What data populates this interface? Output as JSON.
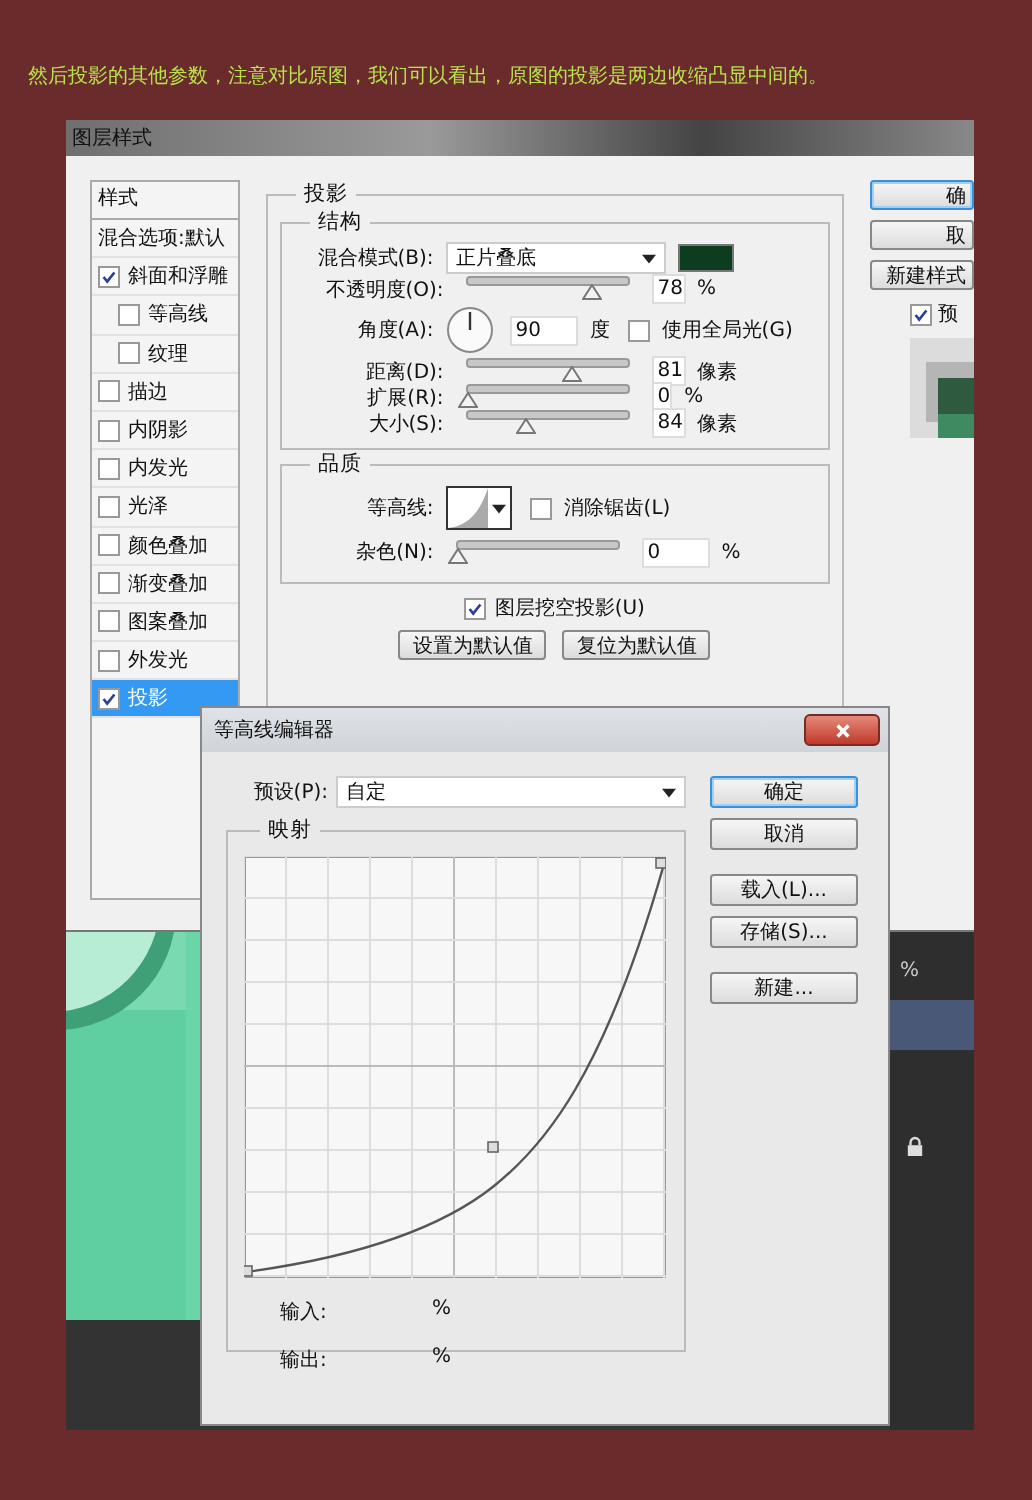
{
  "caption": "然后投影的其他参数，注意对比原图，我们可以看出，原图的投影是两边收缩凸显中间的。",
  "layer_style": {
    "title": "图层样式",
    "styles_header": "样式",
    "styles": [
      {
        "label": "混合选项:默认",
        "kind": "plain",
        "selected": false
      },
      {
        "label": "斜面和浮雕",
        "kind": "check",
        "checked": true,
        "selected": false,
        "children": [
          {
            "label": "等高线",
            "kind": "check",
            "checked": false,
            "selected": false
          },
          {
            "label": "纹理",
            "kind": "check",
            "checked": false,
            "selected": false
          }
        ]
      },
      {
        "label": "描边",
        "kind": "check",
        "checked": false,
        "selected": false
      },
      {
        "label": "内阴影",
        "kind": "check",
        "checked": false,
        "selected": false
      },
      {
        "label": "内发光",
        "kind": "check",
        "checked": false,
        "selected": false
      },
      {
        "label": "光泽",
        "kind": "check",
        "checked": false,
        "selected": false
      },
      {
        "label": "颜色叠加",
        "kind": "check",
        "checked": false,
        "selected": false
      },
      {
        "label": "渐变叠加",
        "kind": "check",
        "checked": false,
        "selected": false
      },
      {
        "label": "图案叠加",
        "kind": "check",
        "checked": false,
        "selected": false
      },
      {
        "label": "外发光",
        "kind": "check",
        "checked": false,
        "selected": false
      },
      {
        "label": "投影",
        "kind": "check",
        "checked": true,
        "selected": true
      }
    ],
    "section_title": "投影",
    "structure": {
      "title": "结构",
      "rows": [
        {
          "kind": "dropdown",
          "label": "混合模式(B):",
          "value": "正片叠底"
        },
        {
          "kind": "slider",
          "label": "不透明度(O):",
          "level": 0.78,
          "value": "78",
          "unit": "%"
        },
        {
          "kind": "angle",
          "label": "角度(A):",
          "value": "90",
          "unit": "度",
          "global_light": {
            "label": "使用全局光(G)",
            "checked": false
          }
        },
        {
          "kind": "slider",
          "label": "距离(D):",
          "level": 0.65,
          "value": "81",
          "unit": "像素"
        },
        {
          "kind": "slider",
          "label": "扩展(R):",
          "level": 0,
          "value": "0",
          "unit": "%"
        },
        {
          "kind": "slider",
          "label": "大小(S):",
          "level": 0.37,
          "value": "84",
          "unit": "像素"
        }
      ]
    },
    "quality": {
      "title": "品质",
      "rows": [
        {
          "kind": "contour",
          "label": "等高线:",
          "anti_alias": {
            "label": "消除锯齿(L)",
            "checked": false
          }
        },
        {
          "kind": "slider",
          "label": "杂色(N):",
          "level": 0,
          "value": "0",
          "unit": "%"
        }
      ]
    },
    "knockout": {
      "label": "图层挖空投影(U)",
      "checked": true
    },
    "buttons": [
      "设置为默认值",
      "复位为默认值"
    ],
    "side_buttons": [
      {
        "label": "确",
        "default": true
      },
      {
        "label": "取",
        "default": false
      },
      {
        "label": "新建样式",
        "default": false
      }
    ],
    "preview": {
      "label": "预",
      "checked": true
    }
  },
  "contour_editor": {
    "title": "等高线编辑器",
    "preset": {
      "label": "预设(P):",
      "value": "自定"
    },
    "mapping": {
      "title": "映射",
      "input_label": "输入:",
      "input_unit": "%",
      "output_label": "输出:",
      "output_unit": "%"
    },
    "buttons": [
      {
        "label": "确定",
        "default": true
      },
      {
        "label": "取消",
        "default": false
      },
      {
        "label": "载入(L)...",
        "default": false
      },
      {
        "label": "存储(S)...",
        "default": false
      },
      {
        "label": "新建...",
        "default": false
      }
    ]
  },
  "layers_panel": {
    "opacity_unit": "%"
  }
}
